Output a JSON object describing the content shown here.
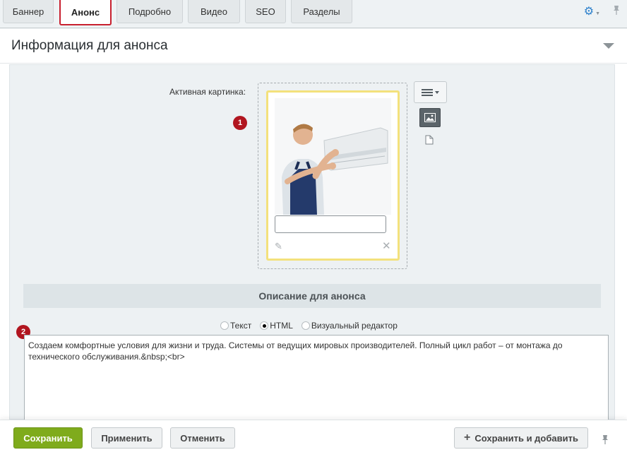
{
  "tabs": [
    {
      "label": "Баннер",
      "active": false
    },
    {
      "label": "Анонс",
      "active": true
    },
    {
      "label": "Подробно",
      "active": false
    },
    {
      "label": "Видео",
      "active": false
    },
    {
      "label": "SEO",
      "active": false
    },
    {
      "label": "Разделы",
      "active": false
    }
  ],
  "section": {
    "title": "Информация для анонса"
  },
  "image_field": {
    "label": "Активная картинка:",
    "badge": "1",
    "description_value": ""
  },
  "description": {
    "section_title": "Описание для анонса",
    "badge": "2",
    "modes": [
      {
        "label": "Текст",
        "checked": false
      },
      {
        "label": "HTML",
        "checked": true
      },
      {
        "label": "Визуальный редактор",
        "checked": false
      }
    ],
    "text": "Создаем комфортные условия для жизни и труда. Системы от ведущих мировых производителей. Полный цикл работ – от монтажа до технического обслуживания.&nbsp;<br>"
  },
  "footer": {
    "save": "Сохранить",
    "apply": "Применить",
    "cancel": "Отменить",
    "save_add": "Сохранить и добавить"
  },
  "colors": {
    "active_tab_border": "#c8202f",
    "badge": "#b1151f",
    "primary_button": "#7fab1c",
    "image_card_border": "#f3e17c",
    "gear": "#2a7fcb"
  },
  "icons": {
    "settings": "gear-icon",
    "pin": "pin-icon",
    "collapse": "chevron-down-icon",
    "menu": "hamburger-icon",
    "image_mode": "image-icon",
    "file_mode": "file-icon",
    "edit": "pencil-icon",
    "delete": "close-icon",
    "add": "plus-icon"
  }
}
